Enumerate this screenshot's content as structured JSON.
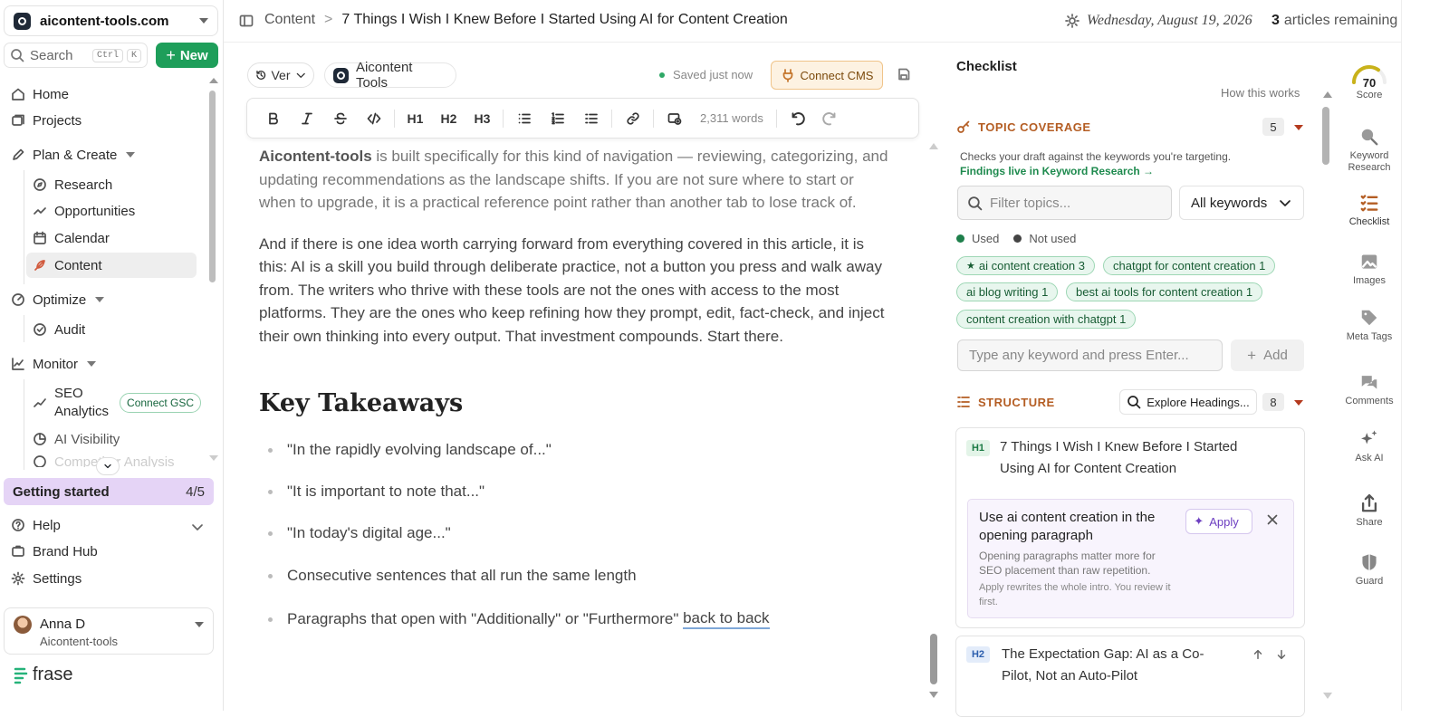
{
  "workspace": {
    "name": "aicontent-tools.com"
  },
  "search": {
    "label": "Search",
    "kbd1": "Ctrl",
    "kbd2": "K"
  },
  "new_button": "New",
  "nav": {
    "home": "Home",
    "projects": "Projects",
    "plan_create": "Plan & Create",
    "research": "Research",
    "opportunities": "Opportunities",
    "calendar": "Calendar",
    "content": "Content",
    "optimize": "Optimize",
    "audit": "Audit",
    "monitor": "Monitor",
    "seo_analytics_1": "SEO",
    "seo_analytics_2": "Analytics",
    "connect_gsc": "Connect GSC",
    "ai_visibility": "AI Visibility",
    "competitor_analysis": "Competitor Analysis"
  },
  "getting_started": {
    "label": "Getting started",
    "progress": "4/5"
  },
  "bottom_nav": {
    "help": "Help",
    "brand_hub": "Brand Hub",
    "settings": "Settings"
  },
  "user": {
    "name": "Anna D",
    "org": "Aicontent-tools"
  },
  "logo": "frase",
  "header": {
    "breadcrumb_root": "Content",
    "breadcrumb_title": "7 Things I Wish I Knew Before I Started Using AI for Content Creation",
    "date": "Wednesday, August 19, 2026",
    "articles_count": "3",
    "articles_label": "articles remaining"
  },
  "editor_top": {
    "version": "Ver",
    "brand": "Aicontent Tools",
    "saved": "Saved just now",
    "connect_cms": "Connect CMS"
  },
  "toolbar": {
    "h1": "H1",
    "h2": "H2",
    "h3": "H3",
    "word_count": "2,311 words"
  },
  "content": {
    "p1_bold": "Aicontent-tools",
    "p1_rest": " is built specifically for this kind of navigation — reviewing, categorizing, and updating recommendations as the landscape shifts. If you are not sure where to start or when to upgrade, it is a practical reference point rather than another tab to lose track of.",
    "p2": "And if there is one idea worth carrying forward from everything covered in this article, it is this: AI is a skill you build through deliberate practice, not a button you press and walk away from. The writers who thrive with these tools are not the ones with access to the most platforms. They are the ones who keep refining how they prompt, edit, fact-check, and inject their own thinking into every output. That investment compounds. Start there.",
    "heading": "Key Takeaways",
    "bullets": [
      "\"In the rapidly evolving landscape of...\"",
      "\"It is important to note that...\"",
      "\"In today's digital age...\"",
      "Consecutive sentences that all run the same length",
      "Paragraphs that open with \"Additionally\" or \"Furthermore\" "
    ],
    "bullet5_link": "back to back"
  },
  "panel": {
    "title": "Checklist",
    "how_it_works": "How this works",
    "topic_coverage": {
      "label": "TOPIC COVERAGE",
      "count": "5",
      "desc": "Checks your draft against the keywords you're targeting.",
      "link": "Findings live in Keyword Research →",
      "filter_placeholder": "Filter topics...",
      "dropdown": "All keywords",
      "legend_used": "Used",
      "legend_not_used": "Not used",
      "chips": [
        "ai content creation 3",
        "chatgpt for content creation 1",
        "ai blog writing 1",
        "best ai tools for content creation 1",
        "content creation with chatgpt 1"
      ],
      "keyword_placeholder": "Type any keyword and press Enter...",
      "add": "Add"
    },
    "structure": {
      "label": "STRUCTURE",
      "explore": "Explore Headings...",
      "count": "8",
      "h1_badge": "H1",
      "h1_text": "7 Things I Wish I Knew Before I Started Using AI for Content Creation",
      "suggestion_title": "Use ai content creation in the opening paragraph",
      "suggestion_desc": "Opening paragraphs matter more for SEO placement than raw repetition.",
      "suggestion_note": "Apply rewrites the whole intro. You review it first.",
      "apply": "Apply",
      "h2_badge": "H2",
      "h2_text": "The Expectation Gap: AI as a Co-Pilot, Not an Auto-Pilot"
    }
  },
  "rail": {
    "score_value": "70",
    "score_fraction": 0.7,
    "score_label": "Score",
    "keyword_research": "Keyword Research",
    "checklist": "Checklist",
    "images": "Images",
    "meta_tags": "Meta Tags",
    "comments": "Comments",
    "ask_ai": "Ask AI",
    "share": "Share",
    "guard": "Guard"
  },
  "colors": {
    "accent_green": "#1e9e5a",
    "section_orange": "#b45d23",
    "getting_started_bg": "#e5d4f6",
    "chip_bg": "#e8f6ee"
  }
}
